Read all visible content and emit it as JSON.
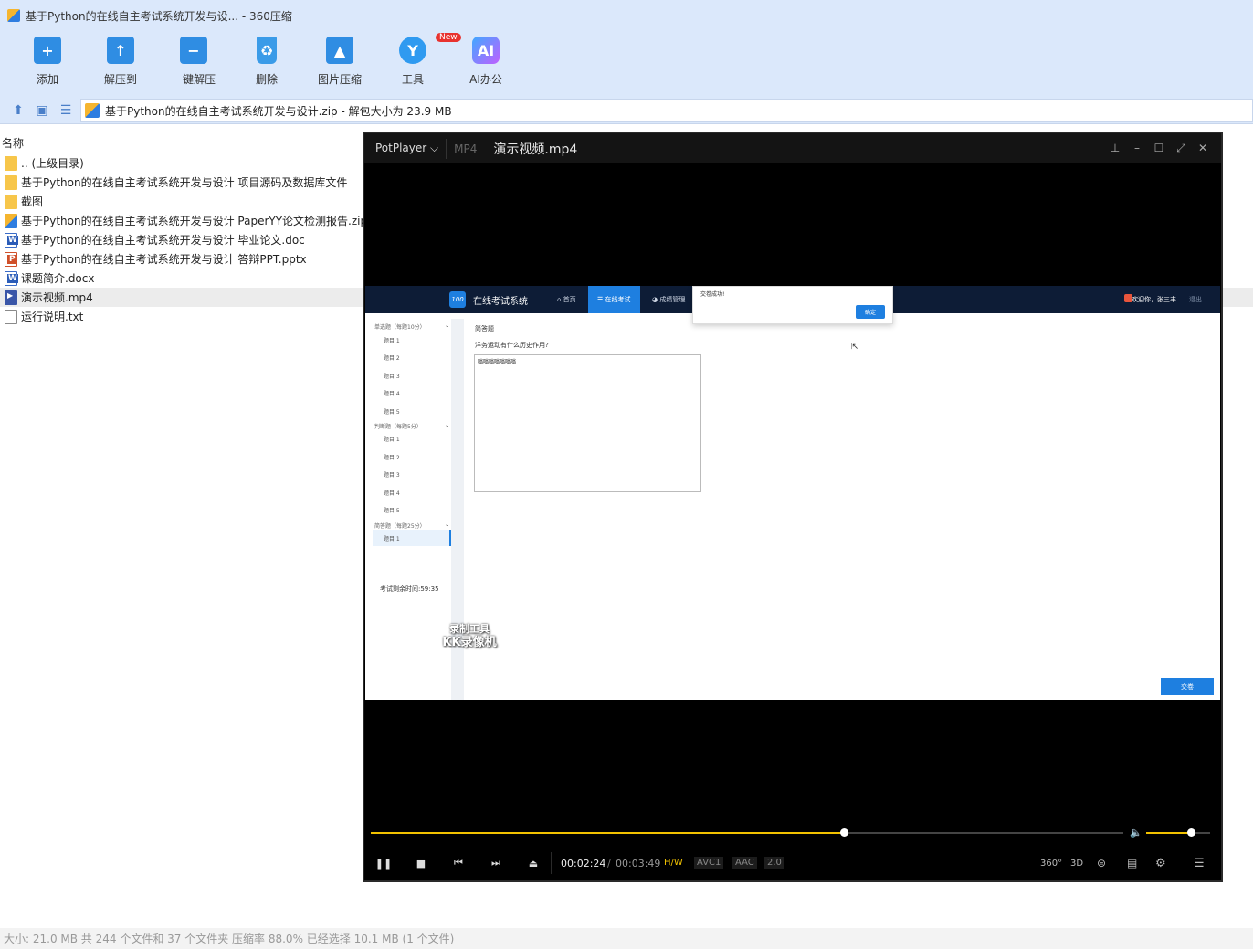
{
  "window": {
    "title": "基于Python的在线自主考试系统开发与设... - 360压缩"
  },
  "toolbar": {
    "items": [
      {
        "label": "添加",
        "icon": "add-folder-icon"
      },
      {
        "label": "解压到",
        "icon": "extract-to-icon"
      },
      {
        "label": "一键解压",
        "icon": "one-click-extract-icon"
      },
      {
        "label": "删除",
        "icon": "delete-trash-icon"
      },
      {
        "label": "图片压缩",
        "icon": "image-compress-icon"
      },
      {
        "label": "工具",
        "icon": "tools-icon",
        "badge": "New"
      },
      {
        "label": "AI办公",
        "icon": "ai-office-icon",
        "glyph": "AI"
      }
    ]
  },
  "address": {
    "path": "基于Python的在线自主考试系统开发与设计.zip - 解包大小为 23.9 MB"
  },
  "filelist": {
    "header": "名称",
    "rows": [
      {
        "name": ".. (上级目录)",
        "type": "folder"
      },
      {
        "name": "基于Python的在线自主考试系统开发与设计 项目源码及数据库文件",
        "type": "folder"
      },
      {
        "name": "截图",
        "type": "folder"
      },
      {
        "name": "基于Python的在线自主考试系统开发与设计 PaperYY论文检测报告.zip",
        "type": "zip"
      },
      {
        "name": "基于Python的在线自主考试系统开发与设计 毕业论文.doc",
        "type": "doc"
      },
      {
        "name": "基于Python的在线自主考试系统开发与设计 答辩PPT.pptx",
        "type": "ppt"
      },
      {
        "name": "课题简介.docx",
        "type": "doc"
      },
      {
        "name": "演示视频.mp4",
        "type": "mp4",
        "selected": true
      },
      {
        "name": "运行说明.txt",
        "type": "txt"
      }
    ]
  },
  "status": {
    "text": "大小: 21.0 MB 共 244 个文件和 37 个文件夹 压缩率 88.0% 已经选择 10.1 MB (1 个文件)"
  },
  "player": {
    "brand": "PotPlayer",
    "brand_chevron": "⌵",
    "format": "MP4",
    "file": "演示视频.mp4",
    "time_current": "00:02:24",
    "time_sep": "/",
    "time_total": "00:03:49",
    "progress_fraction": 0.6288,
    "volume_fraction": 0.7,
    "codecs": {
      "hw": "H/W",
      "video": "AVC1",
      "audio": "AAC",
      "channels": "2.0"
    },
    "right_buttons": [
      "360°",
      "3D"
    ],
    "colors": {
      "accent": "#f2c200",
      "background": "#000000"
    }
  },
  "video": {
    "site_name": "在线考试系统",
    "logo_text": "100",
    "nav": [
      {
        "label": "⌂ 首页"
      },
      {
        "label": "☰ 在线考试",
        "active": true
      },
      {
        "label": "◕ 成绩管理"
      }
    ],
    "user": "欢迎你，张三丰",
    "logout": "退出",
    "toast": {
      "text": "交卷成功!",
      "confirm": "确定"
    },
    "sections": [
      {
        "title": "单选题（每题10分）",
        "items": [
          "题目 1",
          "题目 2",
          "题目 3",
          "题目 4",
          "题目 5"
        ]
      },
      {
        "title": "判断题（每题5分）",
        "items": [
          "题目 1",
          "题目 2",
          "题目 3",
          "题目 4",
          "题目 5"
        ]
      },
      {
        "title": "简答题（每题25分）",
        "items": [
          "题目 1"
        ]
      }
    ],
    "timer": "考试剩余时间:59:35",
    "question_type": "简答题",
    "question": "洋务运动有什么历史作用?",
    "answer": "嗡嗡嗡嗡嗡嗡嗡",
    "submit": "交卷",
    "watermark_line1": "录制工具",
    "watermark_line2": "KK录像机"
  }
}
